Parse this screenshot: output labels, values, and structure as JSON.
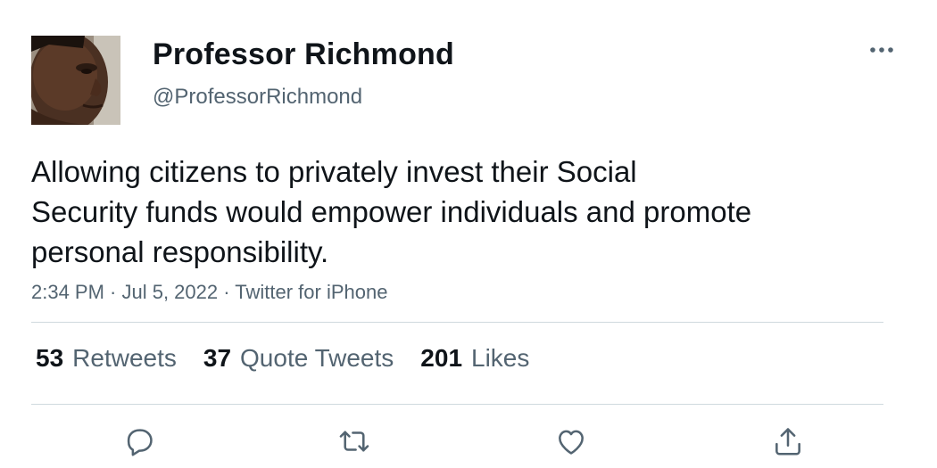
{
  "user": {
    "display_name": "Professor Richmond",
    "handle": "@ProfessorRichmond"
  },
  "tweet": {
    "lines": [
      "Allowing citizens to privately invest their Social",
      "Security funds would empower individuals and promote",
      "personal responsibility."
    ],
    "meta": "2:34 PM · Jul 5, 2022 · Twitter for iPhone"
  },
  "stats": {
    "retweets": {
      "count": "53",
      "label": "Retweets"
    },
    "quotes": {
      "count": "37",
      "label": "Quote Tweets"
    },
    "likes": {
      "count": "201",
      "label": "Likes"
    }
  },
  "actions": [
    "reply-icon",
    "retweet-icon",
    "like-icon",
    "share-icon"
  ],
  "colors": {
    "text": "#0f1419",
    "secondary": "#536471",
    "divider": "#cfd9de"
  }
}
